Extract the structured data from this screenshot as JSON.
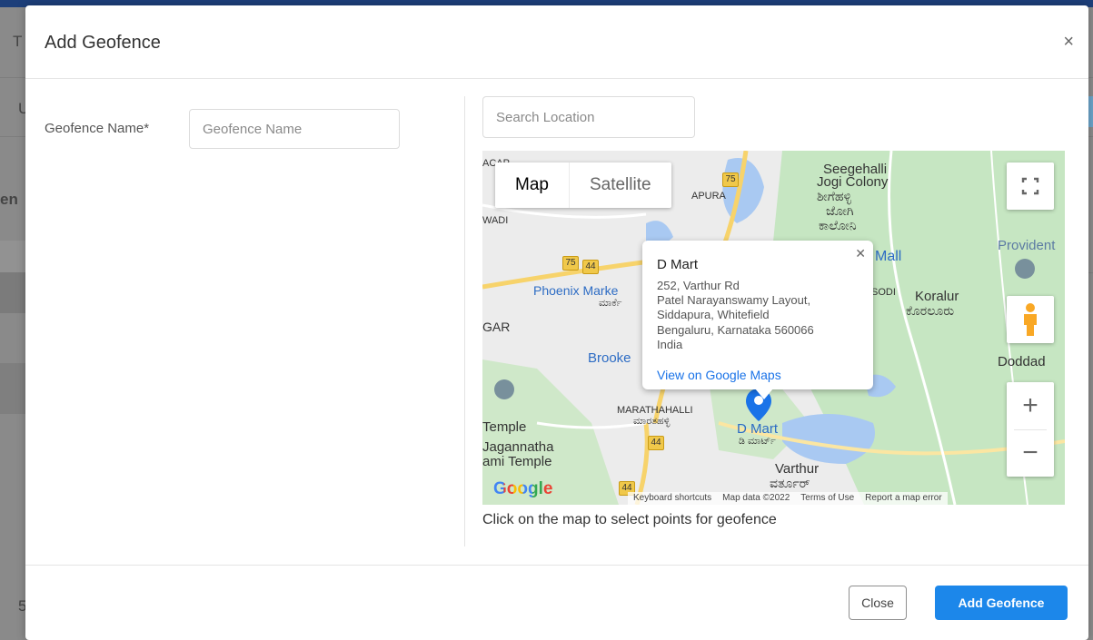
{
  "background": {
    "fragments": [
      "T",
      "U",
      "en",
      "5"
    ]
  },
  "modal": {
    "title": "Add Geofence",
    "close_glyph": "×",
    "geofence_name": {
      "label": "Geofence Name*",
      "placeholder": "Geofence Name",
      "value": ""
    },
    "search": {
      "placeholder": "Search Location",
      "value": ""
    },
    "hint": "Click on the map to select points for geofence",
    "buttons": {
      "close": "Close",
      "add": "Add Geofence"
    }
  },
  "map": {
    "map_type": {
      "map": "Map",
      "satellite": "Satellite",
      "selected": "Map"
    },
    "labels": {
      "seegehalli": "Seegehalli",
      "jogi_colony": "Jogi Colony",
      "kannada_1": "ಶೀಗೆಹಳ್ಳಿ",
      "kannada_2": "ಜೋಗಿ",
      "kannada_3": "ಕಾಲೋನಿ",
      "acap": "ACAP",
      "apura": "APURA",
      "wadi": "WADI",
      "phoenix": "Phoenix Marke",
      "market_kn": "ಮಾರ್ಕೆ",
      "gar": "GAR",
      "brooke": "Brooke",
      "mall": "Mall",
      "provident": "Provident",
      "koralur": "Koralur",
      "koralur_kn": "ಕೊರಲೂರು",
      "sodi": "SODI",
      "doddad": "Doddad",
      "marathahalli": "MARATHAHALLI",
      "marathahalli_kn": "ಮಾರತಹಳ್ಳಿ",
      "temple": "Temple",
      "jagannatha": "Jagannatha",
      "ami_temple": "ami Temple",
      "dmart_marker": "D Mart",
      "dmart_kn": "ಡಿ ಮಾರ್ಟ್",
      "varthur": "Varthur",
      "varthur_kn": "ವರ್ತೂರ್",
      "google": "Google"
    },
    "highways": [
      "75",
      "75",
      "44",
      "44",
      "44"
    ],
    "popup": {
      "title": "D Mart",
      "address": [
        "252, Varthur Rd",
        "Patel Narayanswamy Layout,",
        "Siddapura, Whitefield",
        "Bengaluru, Karnataka 560066",
        "India"
      ],
      "link": "View on Google Maps"
    },
    "footer": [
      "Keyboard shortcuts",
      "Map data ©2022",
      "Terms of Use",
      "Report a map error"
    ],
    "zoom_in": "+",
    "zoom_out": "−",
    "colors": {
      "accent": "#1c87ea",
      "green": "#c6e6c2",
      "water": "#a9c9f2",
      "road": "#f7d36b"
    }
  }
}
